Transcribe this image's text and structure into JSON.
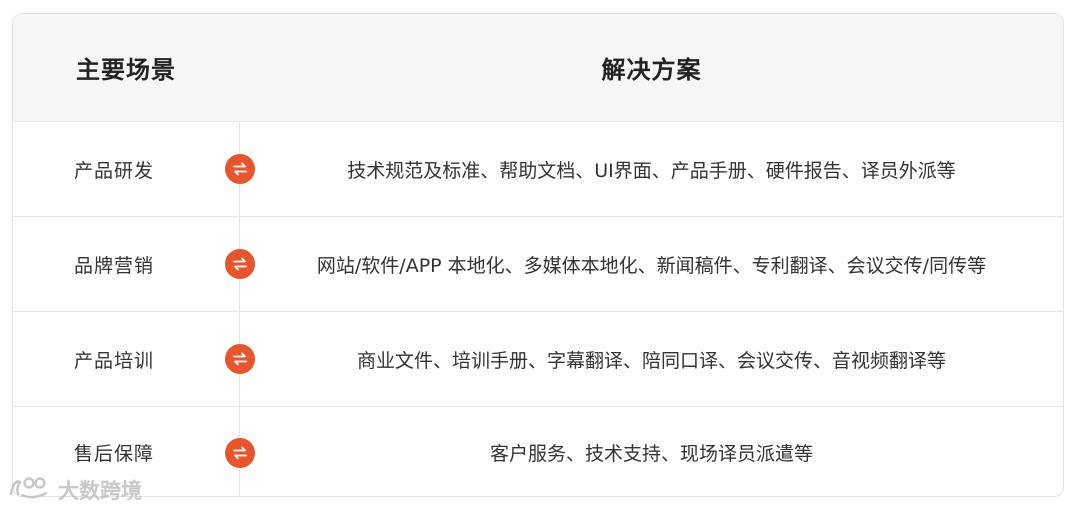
{
  "header": {
    "scene_label": "主要场景",
    "solution_label": "解决方案"
  },
  "rows": [
    {
      "scene": "产品研发",
      "solution": "技术规范及标准、帮助文档、UI界面、产品手册、硬件报告、译员外派等"
    },
    {
      "scene": "品牌营销",
      "solution": "网站/软件/APP 本地化、多媒体本地化、新闻稿件、专利翻译、会议交传/同传等"
    },
    {
      "scene": "产品培训",
      "solution": "商业文件、培训手册、字幕翻译、陪同口译、会议交传、音视频翻译等"
    },
    {
      "scene": "售后保障",
      "solution": "客户服务、技术支持、现场译员派遣等"
    }
  ],
  "icons": {
    "row_icon": "swap-arrows-icon",
    "watermark_logo": "brand-logo-icon"
  },
  "colors": {
    "accent": "#e8542b",
    "header_bg": "#f6f6f6",
    "border": "#e6e6e6"
  },
  "watermark": {
    "text": "大数跨境"
  }
}
